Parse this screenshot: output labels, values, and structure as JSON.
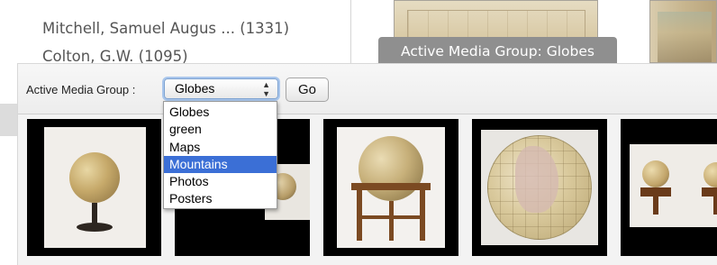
{
  "background": {
    "links": [
      {
        "text": "Mitchell, Samuel Augus ... (1331)"
      },
      {
        "text": "Colton, G.W. (1095)"
      }
    ]
  },
  "tooltip": {
    "text": "Active Media Group: Globes"
  },
  "panel": {
    "group_label": "Active Media Group :",
    "select": {
      "value": "Globes",
      "arrows_icon": "up-down-arrows-icon"
    },
    "go_label": "Go",
    "dropdown": {
      "options": [
        "Globes",
        "green",
        "Maps",
        "Mountains",
        "Photos",
        "Posters"
      ],
      "highlighted": "Mountains"
    }
  },
  "thumbnails": [
    {
      "subject": "globe-on-iron-stand"
    },
    {
      "subject": "small-globe-photo"
    },
    {
      "subject": "globe-on-wooden-stand"
    },
    {
      "subject": "world-globe-closeup"
    },
    {
      "subject": "pair-of-globes"
    }
  ],
  "colors": {
    "tooltip_bg": "#8f8f8f",
    "selection_bg": "#3b6fd6",
    "thumb_bg": "#000000"
  }
}
